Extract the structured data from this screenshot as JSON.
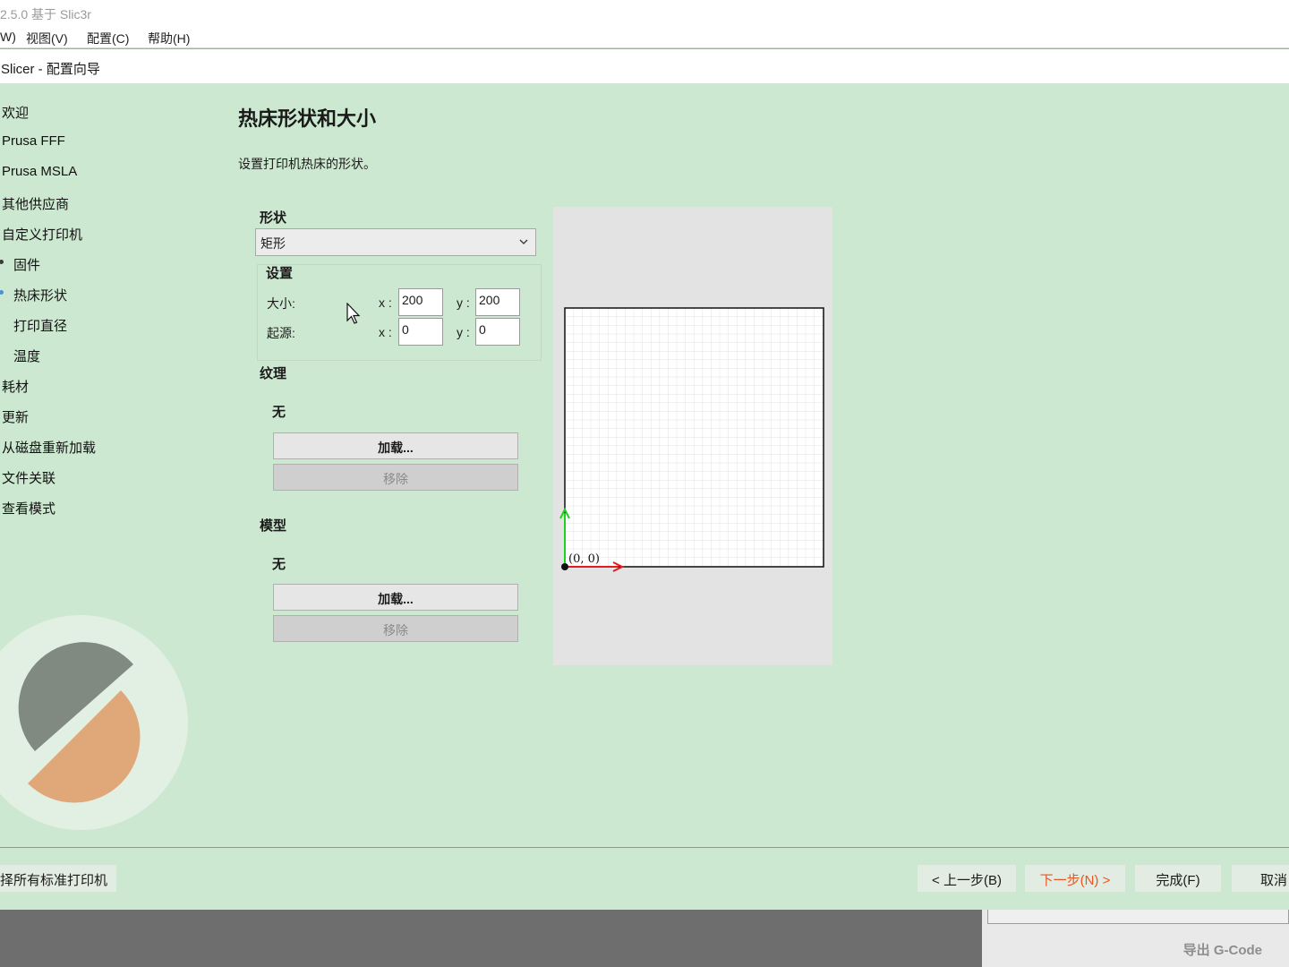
{
  "app": {
    "title": "2.5.0 基于 Slic3r",
    "menu": [
      "W)",
      "视图(V)",
      "配置(C)",
      "帮助(H)"
    ]
  },
  "dialog": {
    "title": "Slicer - 配置向导",
    "sidebar": [
      "欢迎",
      "Prusa FFF",
      "Prusa MSLA",
      "其他供应商",
      "自定义打印机",
      "固件",
      "热床形状",
      "打印直径",
      "温度",
      "耗材",
      "更新",
      "从磁盘重新加载",
      "文件关联",
      "查看模式"
    ],
    "page_title": "热床形状和大小",
    "page_desc": "设置打印机热床的形状。",
    "shape": {
      "label": "形状",
      "value": "矩形"
    },
    "settings": {
      "label": "设置",
      "size_label": "大小:",
      "origin_label": "起源:",
      "x_label": "x :",
      "y_label": "y :",
      "size_x": "200",
      "size_y": "200",
      "origin_x": "0",
      "origin_y": "0"
    },
    "texture": {
      "label": "纹理",
      "value": "无",
      "load": "加载...",
      "remove": "移除"
    },
    "model": {
      "label": "模型",
      "value": "无",
      "load": "加载...",
      "remove": "移除"
    },
    "preview": {
      "origin_text": "(0, 0)"
    },
    "footer": {
      "select_all": "择所有标准打印机",
      "back": "< 上一步(B)",
      "next": "下一步(N) >",
      "finish": "完成(F)",
      "cancel": "取消"
    }
  },
  "main_window": {
    "export": "导出 G-Code"
  },
  "colors": {
    "dialog_bg": "#cde8d0",
    "next_accent": "#e8571f",
    "axis_x": "#e21b1b",
    "axis_y": "#20d020",
    "logo_gray": "#808a80",
    "logo_orange": "#e0a878"
  }
}
